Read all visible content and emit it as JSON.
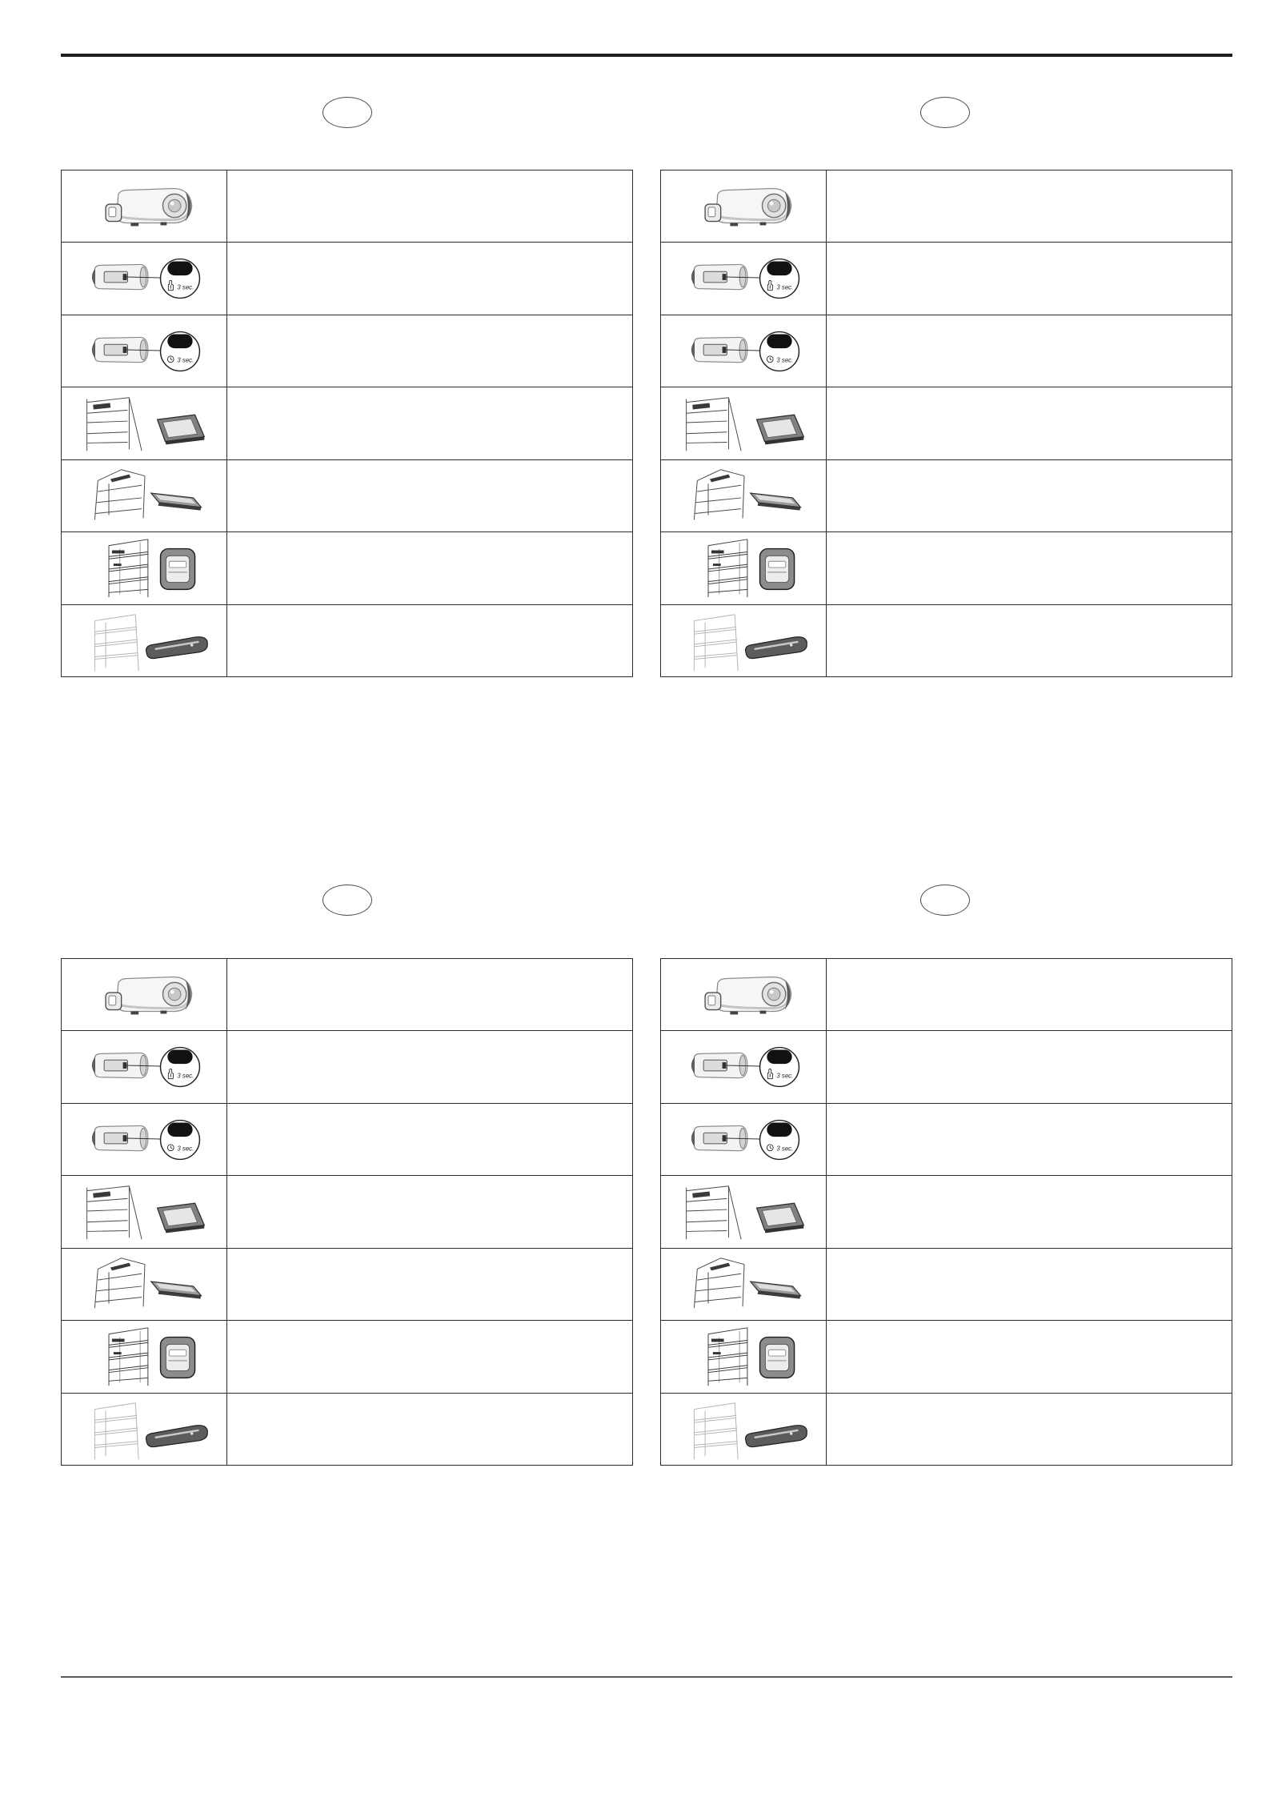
{
  "page": {
    "sections": [
      {
        "rows": [
          {
            "illustration": "lamp-module-icon"
          },
          {
            "illustration": "lamp-button-hold-icon",
            "zoom_icon": "hand-icon",
            "zoom_label": "3 sec."
          },
          {
            "illustration": "lamp-button-timer-icon",
            "zoom_icon": "clock-icon",
            "zoom_label": "3 sec."
          },
          {
            "illustration": "fridge-light-cover-wide-icon"
          },
          {
            "illustration": "fridge-light-cover-slim-icon"
          },
          {
            "illustration": "fridge-light-square-icon"
          },
          {
            "illustration": "fridge-light-bar-icon"
          }
        ]
      },
      {
        "rows": [
          {
            "illustration": "lamp-module-icon"
          },
          {
            "illustration": "lamp-button-hold-icon",
            "zoom_icon": "hand-icon",
            "zoom_label": "3 sec."
          },
          {
            "illustration": "lamp-button-timer-icon",
            "zoom_icon": "clock-icon",
            "zoom_label": "3 sec."
          },
          {
            "illustration": "fridge-light-cover-wide-icon"
          },
          {
            "illustration": "fridge-light-cover-slim-icon"
          },
          {
            "illustration": "fridge-light-square-icon"
          },
          {
            "illustration": "fridge-light-bar-icon"
          }
        ]
      },
      {
        "rows": [
          {
            "illustration": "lamp-module-icon"
          },
          {
            "illustration": "lamp-button-hold-icon",
            "zoom_icon": "hand-icon",
            "zoom_label": "3 sec."
          },
          {
            "illustration": "lamp-button-timer-icon",
            "zoom_icon": "clock-icon",
            "zoom_label": "3 sec."
          },
          {
            "illustration": "fridge-light-cover-wide-icon"
          },
          {
            "illustration": "fridge-light-cover-slim-icon"
          },
          {
            "illustration": "fridge-light-square-icon"
          },
          {
            "illustration": "fridge-light-bar-icon"
          }
        ]
      },
      {
        "rows": [
          {
            "illustration": "lamp-module-icon"
          },
          {
            "illustration": "lamp-button-hold-icon",
            "zoom_icon": "hand-icon",
            "zoom_label": "3 sec."
          },
          {
            "illustration": "lamp-button-timer-icon",
            "zoom_icon": "clock-icon",
            "zoom_label": "3 sec."
          },
          {
            "illustration": "fridge-light-cover-wide-icon"
          },
          {
            "illustration": "fridge-light-cover-slim-icon"
          },
          {
            "illustration": "fridge-light-square-icon"
          },
          {
            "illustration": "fridge-light-bar-icon"
          }
        ]
      }
    ]
  }
}
